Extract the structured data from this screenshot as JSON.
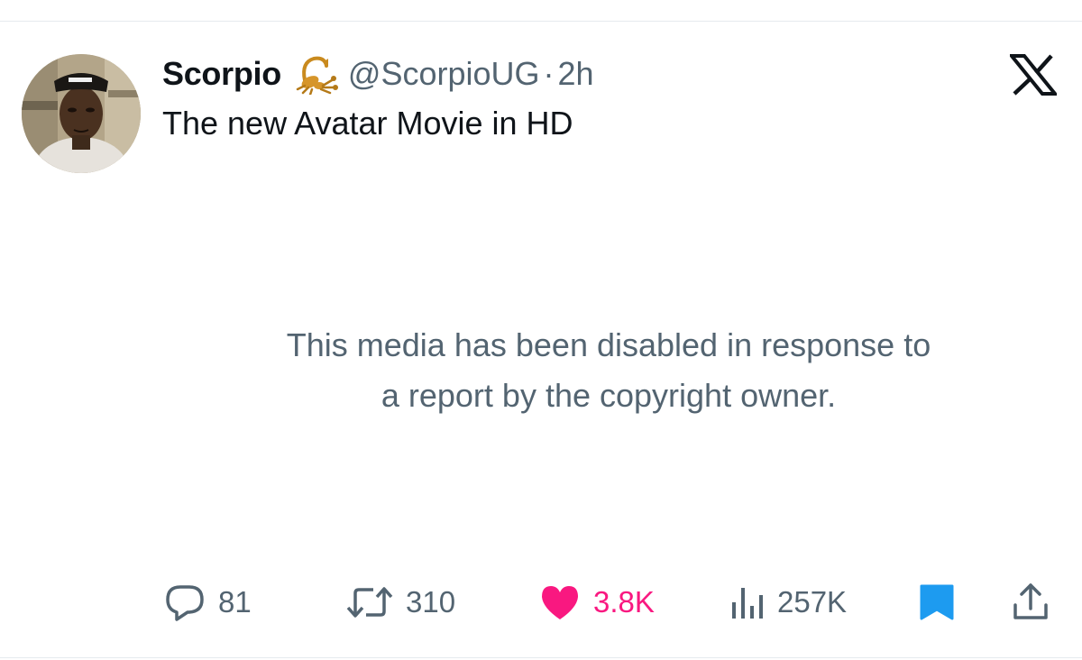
{
  "tweet": {
    "display_name": "Scorpio",
    "badge_icon": "scorpion-emoji",
    "handle": "@ScorpioUG",
    "separator": "·",
    "time": "2h",
    "text": "The new Avatar Movie in HD"
  },
  "media_notice": {
    "line1": "This media has been disabled in response to",
    "line2": "a report by the copyright owner."
  },
  "actions": {
    "replies": "81",
    "reposts": "310",
    "likes": "3.8K",
    "views": "257K"
  },
  "icons": {
    "platform": "x-logo-icon",
    "reply": "reply-icon",
    "repost": "repost-icon",
    "like": "heart-icon",
    "views": "views-icon",
    "bookmark": "bookmark-icon",
    "share": "share-icon"
  },
  "colors": {
    "text": "#0f1419",
    "secondary": "#536471",
    "like": "#f91880",
    "bookmark": "#1d9bf0"
  }
}
